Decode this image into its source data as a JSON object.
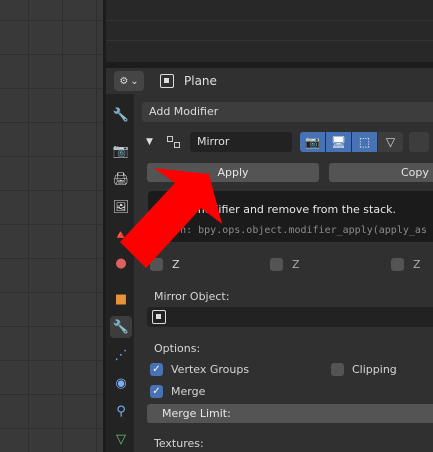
{
  "header": {
    "object_name": "Plane"
  },
  "panel": {
    "add_modifier_label": "Add Modifier",
    "modifier_name": "Mirror",
    "apply_label": "Apply",
    "copy_label": "Copy"
  },
  "tooltip": {
    "description": "modifier and remove from the stack.",
    "python": "ython: bpy.ops.object.modifier_apply(apply_as"
  },
  "axes": {
    "z1": "Z",
    "z2": "Z",
    "z3": "Z"
  },
  "mirror_object_label": "Mirror Object:",
  "options": {
    "label": "Options:",
    "vertex_groups": "Vertex Groups",
    "vertex_groups_checked": true,
    "clipping": "Clipping",
    "clipping_checked": false,
    "merge": "Merge",
    "merge_checked": true,
    "merge_limit": "Merge Limit:"
  },
  "textures_label": "Textures:",
  "colors": {
    "accent": "#4772b3",
    "arrow": "#ff0000"
  }
}
